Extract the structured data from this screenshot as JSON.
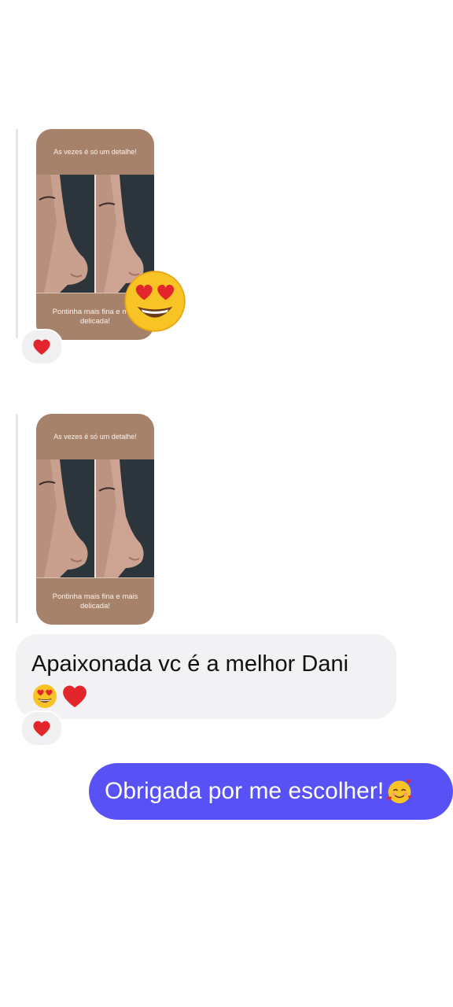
{
  "messages": [
    {
      "type": "story_reply",
      "story": {
        "top_text": "As vezes é só um detalhe!",
        "bottom_text": "Pontinha mais fina e mais delicada!"
      },
      "reaction_overlay_icon": "heart-eyes-emoji",
      "reaction": "heart-icon"
    },
    {
      "type": "story_reply",
      "story": {
        "top_text": "As vezes é só um detalhe!",
        "bottom_text": "Pontinha mais fina e mais delicada!"
      }
    },
    {
      "type": "incoming_text",
      "text": "Apaixonada vc é a melhor Dani",
      "emojis": [
        "heart-eyes-emoji",
        "heart-emoji"
      ],
      "reaction": "heart-icon"
    },
    {
      "type": "outgoing_text",
      "text": "Obrigada por me escolher!",
      "emoji": "smiling-face-with-hearts-emoji"
    }
  ],
  "colors": {
    "story_bg": "#a7826a",
    "incoming_bubble": "#f2f2f5",
    "outgoing_bubble": "#5852f6",
    "heart": "#e3262c"
  }
}
